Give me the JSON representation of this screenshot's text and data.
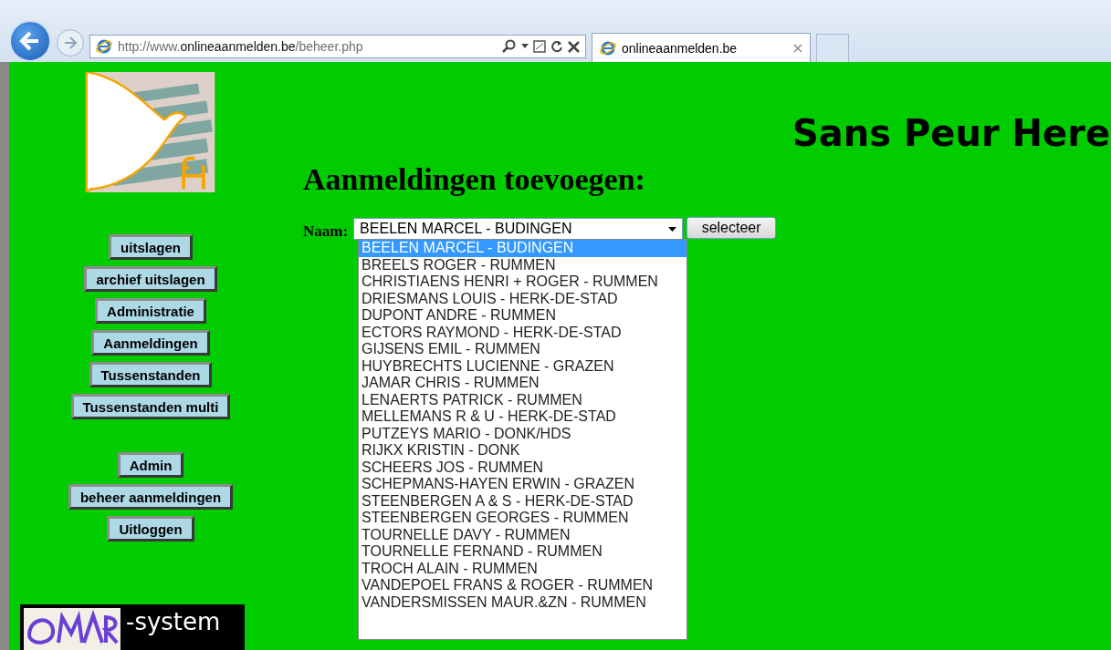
{
  "browser": {
    "url_prefix": "http://www.",
    "url_domain": "onlineaanmelden.be",
    "url_path": "/beheer.php",
    "tab_title": "onlineaanmelden.be"
  },
  "site_title": "Sans Peur Here",
  "nav_main": [
    "uitslagen",
    "archief uitslagen",
    "Administratie",
    "Aanmeldingen",
    "Tussenstanden",
    "Tussenstanden multi"
  ],
  "nav_admin": [
    "Admin",
    "beheer aanmeldingen",
    "Uitloggen"
  ],
  "footer_logo_text": "-system",
  "heading": "Aanmeldingen toevoegen:",
  "form": {
    "label": "Naam:",
    "value": "BEELEN MARCEL - BUDINGEN",
    "button": "selecteer"
  },
  "options": [
    {
      "label": "BEELEN MARCEL - BUDINGEN",
      "selected": true
    },
    {
      "label": "BREELS ROGER - RUMMEN",
      "selected": false
    },
    {
      "label": "CHRISTIAENS HENRI + ROGER - RUMMEN",
      "selected": false
    },
    {
      "label": "DRIESMANS LOUIS - HERK-DE-STAD",
      "selected": false
    },
    {
      "label": "DUPONT ANDRE - RUMMEN",
      "selected": false
    },
    {
      "label": "ECTORS RAYMOND - HERK-DE-STAD",
      "selected": false
    },
    {
      "label": "GIJSENS EMIL - RUMMEN",
      "selected": false
    },
    {
      "label": "HUYBRECHTS LUCIENNE - GRAZEN",
      "selected": false
    },
    {
      "label": "JAMAR CHRIS - RUMMEN",
      "selected": false
    },
    {
      "label": "LENAERTS PATRICK - RUMMEN",
      "selected": false
    },
    {
      "label": "MELLEMANS R & U - HERK-DE-STAD",
      "selected": false
    },
    {
      "label": "PUTZEYS MARIO - DONK/HDS",
      "selected": false
    },
    {
      "label": "RIJKX KRISTIN - DONK",
      "selected": false
    },
    {
      "label": "SCHEERS JOS - RUMMEN",
      "selected": false
    },
    {
      "label": "SCHEPMANS-HAYEN ERWIN - GRAZEN",
      "selected": false
    },
    {
      "label": "STEENBERGEN A & S - HERK-DE-STAD",
      "selected": false
    },
    {
      "label": "STEENBERGEN GEORGES - RUMMEN",
      "selected": false
    },
    {
      "label": "TOURNELLE DAVY - RUMMEN",
      "selected": false
    },
    {
      "label": "TOURNELLE FERNAND - RUMMEN",
      "selected": false
    },
    {
      "label": "TROCH ALAIN - RUMMEN",
      "selected": false
    },
    {
      "label": "VANDEPOEL FRANS & ROGER - RUMMEN",
      "selected": false
    },
    {
      "label": "VANDERSMISSEN MAUR.&ZN - RUMMEN",
      "selected": false
    }
  ]
}
